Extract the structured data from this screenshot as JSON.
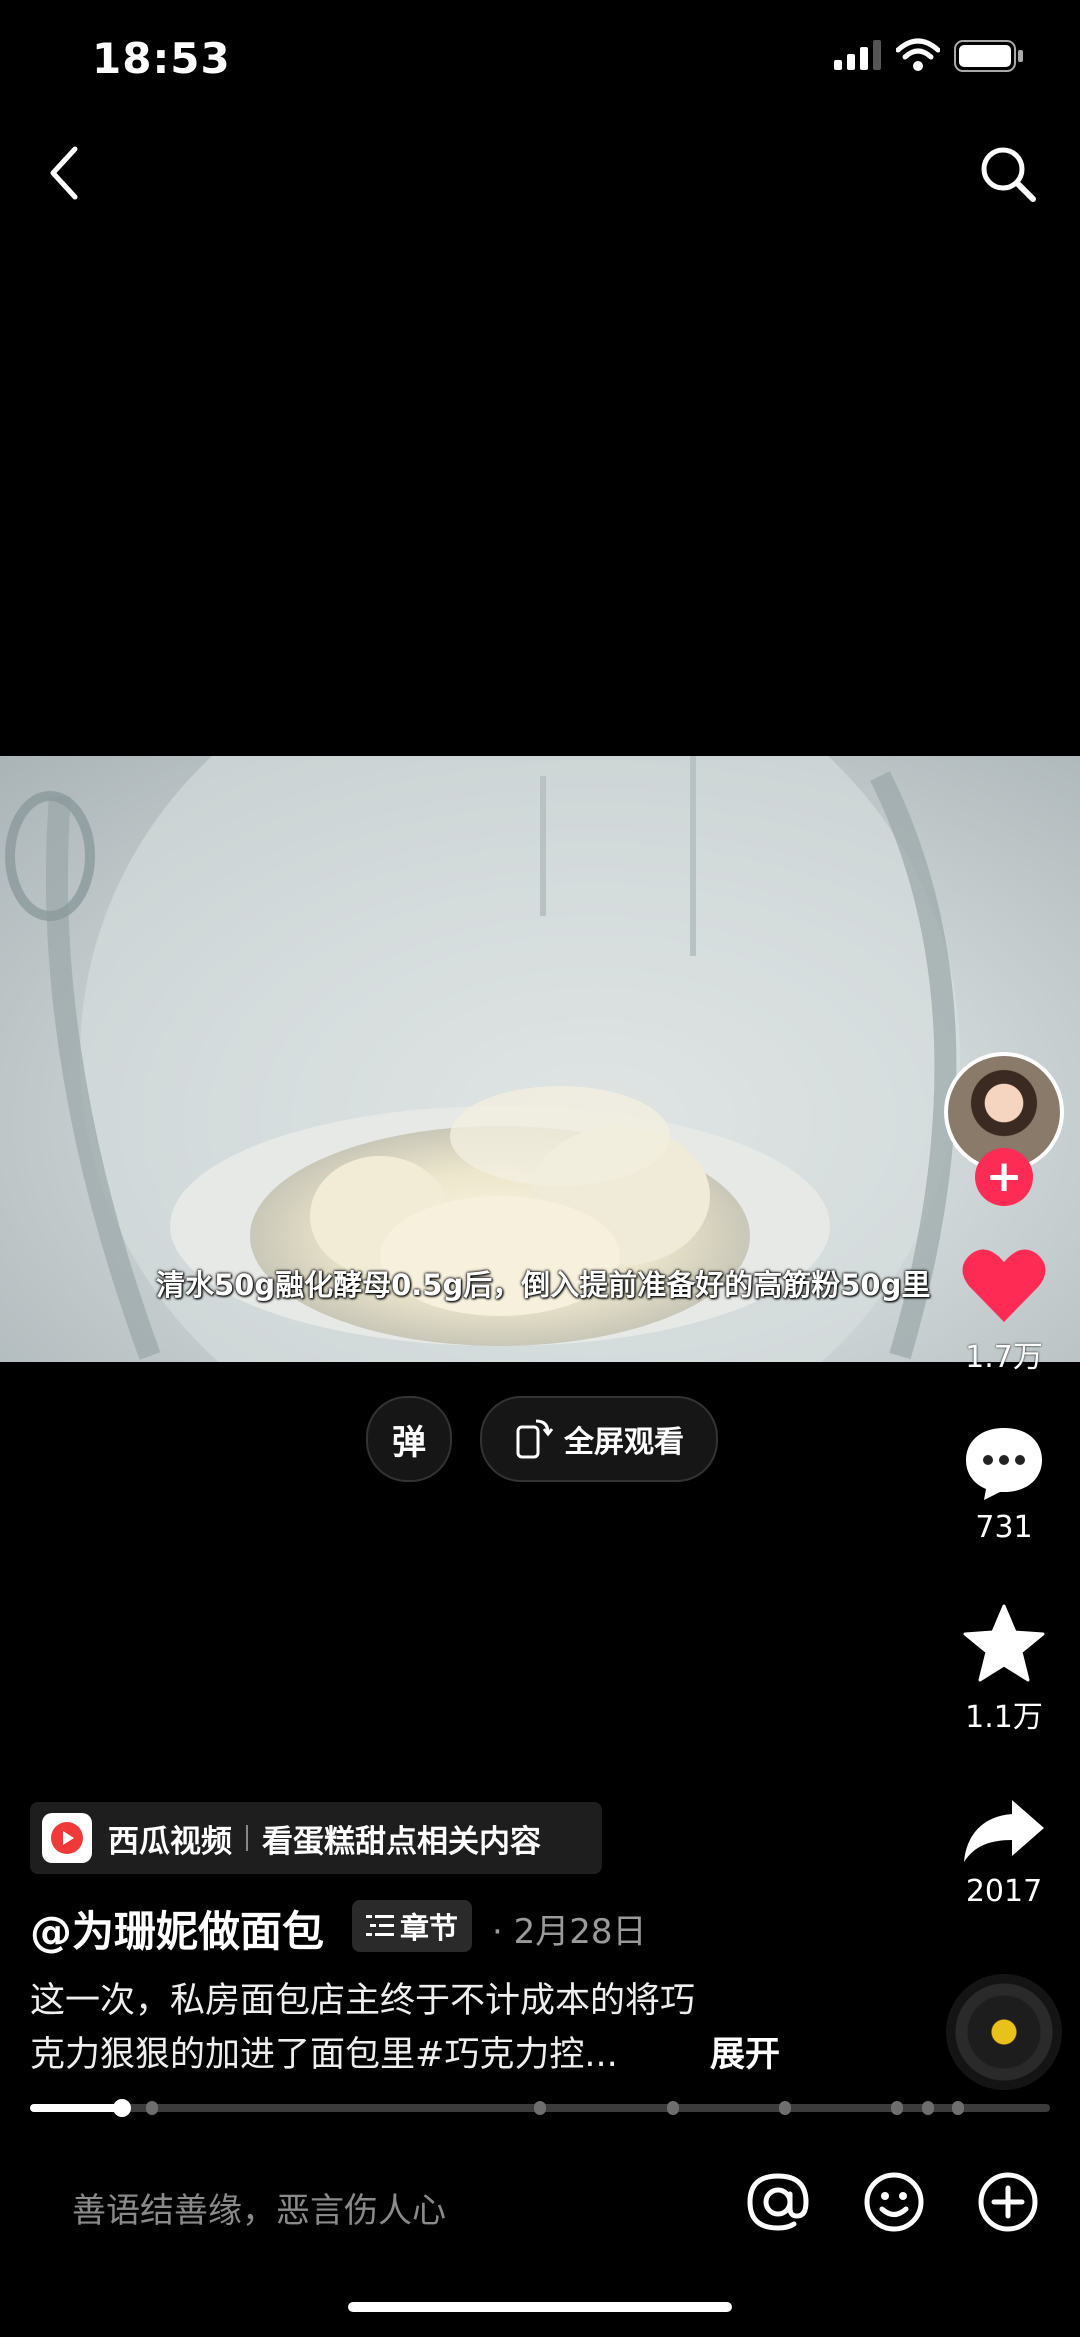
{
  "status_bar": {
    "time": "18:53"
  },
  "video": {
    "caption": "清水50g融化酵母0.5g后，倒入提前准备好的高筋粉50g里"
  },
  "player_controls": {
    "danmaku_label": "弹",
    "fullscreen_label": "全屏观看"
  },
  "actions": {
    "like_count": "1.7万",
    "comment_count": "731",
    "favorite_count": "1.1万",
    "share_count": "2017",
    "follow_symbol": "+"
  },
  "xigua": {
    "app_name": "西瓜视频",
    "related_text": "看蛋糕甜点相关内容"
  },
  "post": {
    "author": "@为珊妮做面包",
    "chapter_label": "章节",
    "date": "· 2月28日",
    "description_line1": "这一次，私房面包店主终于不计成本的将巧",
    "description_line2": "克力狠狠的加进了面包里#巧克力控...",
    "expand_label": "展开"
  },
  "progress": {
    "played_fraction": 0.09,
    "chapter_markers": [
      0.12,
      0.5,
      0.63,
      0.74,
      0.85,
      0.88,
      0.91
    ]
  },
  "comment_bar": {
    "placeholder": "善语结善缘，恶言伤人心"
  },
  "colors": {
    "accent": "#fe2c55",
    "background": "#000000",
    "music_center": "#e8c21a"
  }
}
